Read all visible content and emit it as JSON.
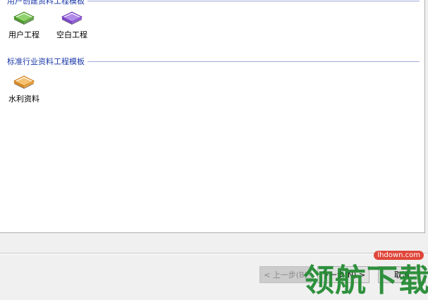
{
  "groups": [
    {
      "title": "用户创建资料工程模板",
      "items": [
        {
          "label": "用户工程",
          "icon": "green-book-icon",
          "color": "#6fbf4a"
        },
        {
          "label": "空白工程",
          "icon": "purple-book-icon",
          "color": "#9b5de5"
        }
      ]
    },
    {
      "title": "标准行业资料工程模板",
      "items": [
        {
          "label": "水利资料",
          "icon": "orange-book-icon",
          "color": "#f0a040"
        }
      ]
    }
  ],
  "buttons": {
    "prev": "< 上一步(B)",
    "next": "下一步(N) >",
    "cancel": "取消"
  },
  "watermark": {
    "text": "领航下载",
    "site": "lhdown.com"
  },
  "colors": {
    "group_title": "#1c3aa9",
    "watermark": "#1f8a2f"
  }
}
